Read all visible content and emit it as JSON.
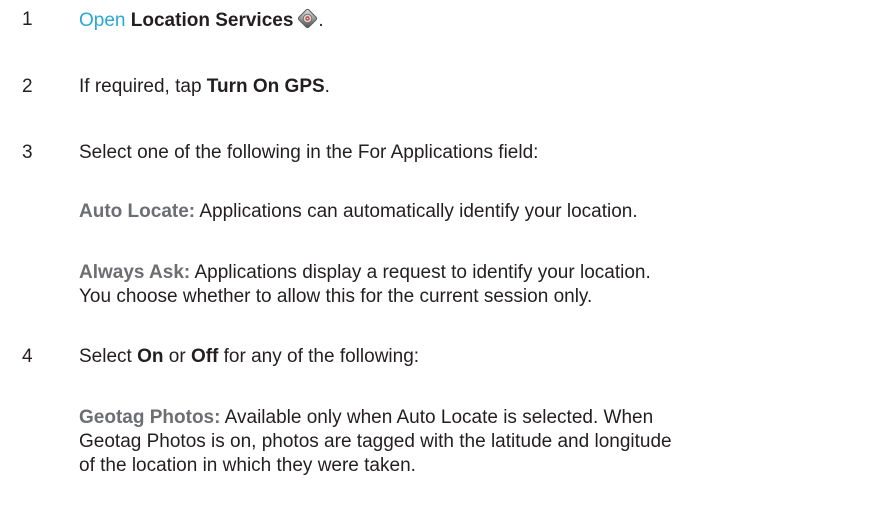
{
  "steps": [
    {
      "number": "1",
      "link_text": "Open",
      "bold_text": "Location Services",
      "icon": "location-services-icon",
      "trailing": "."
    },
    {
      "number": "2",
      "prefix": "If required, tap ",
      "bold_text": "Turn On GPS",
      "trailing": "."
    },
    {
      "number": "3",
      "text": "Select one of the following in the For Applications field:",
      "options": [
        {
          "term": "Auto Locate:",
          "description": " Applications can automatically identify your location."
        },
        {
          "term": "Always Ask:",
          "description_line1": " Applications display a request to identify your location.",
          "description_line2": "You choose whether to allow this for the current session only."
        }
      ]
    },
    {
      "number": "4",
      "prefix": "Select ",
      "bold_on": "On",
      "middle": " or ",
      "bold_off": "Off",
      "suffix": " for any of the following:",
      "options": [
        {
          "term": "Geotag Photos:",
          "description_line1": " Available only when Auto Locate is selected. When",
          "description_line2": "Geotag Photos is on, photos are tagged with the latitude and longitude",
          "description_line3": "of the location in which they were taken."
        }
      ]
    }
  ]
}
